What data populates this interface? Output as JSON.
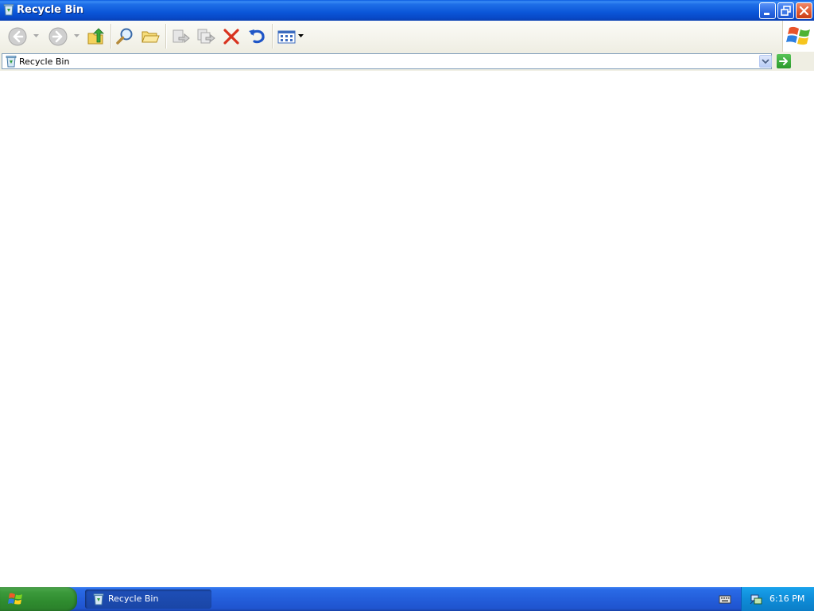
{
  "window": {
    "title": "Recycle Bin"
  },
  "toolbar": {
    "buttons": [
      {
        "name": "back",
        "icon": "back-arrow-icon",
        "enabled": false
      },
      {
        "name": "forward",
        "icon": "forward-arrow-icon",
        "enabled": false
      },
      {
        "name": "up",
        "icon": "folder-up-icon",
        "enabled": true
      },
      {
        "name": "search",
        "icon": "search-icon",
        "enabled": true
      },
      {
        "name": "folders",
        "icon": "folders-icon",
        "enabled": true
      },
      {
        "name": "move-to",
        "icon": "move-to-icon",
        "enabled": false
      },
      {
        "name": "copy-to",
        "icon": "copy-to-icon",
        "enabled": false
      },
      {
        "name": "delete",
        "icon": "delete-x-icon",
        "enabled": true
      },
      {
        "name": "undo",
        "icon": "undo-icon",
        "enabled": true
      },
      {
        "name": "views",
        "icon": "views-icon",
        "enabled": true
      }
    ]
  },
  "address": {
    "value": "Recycle Bin"
  },
  "taskbar": {
    "task_label": "Recycle Bin",
    "clock": "6:16 PM"
  },
  "colors": {
    "titlebar": "#0b56d8",
    "taskbar": "#245edb",
    "start": "#3c9a3c",
    "tray": "#0f8cd8"
  }
}
